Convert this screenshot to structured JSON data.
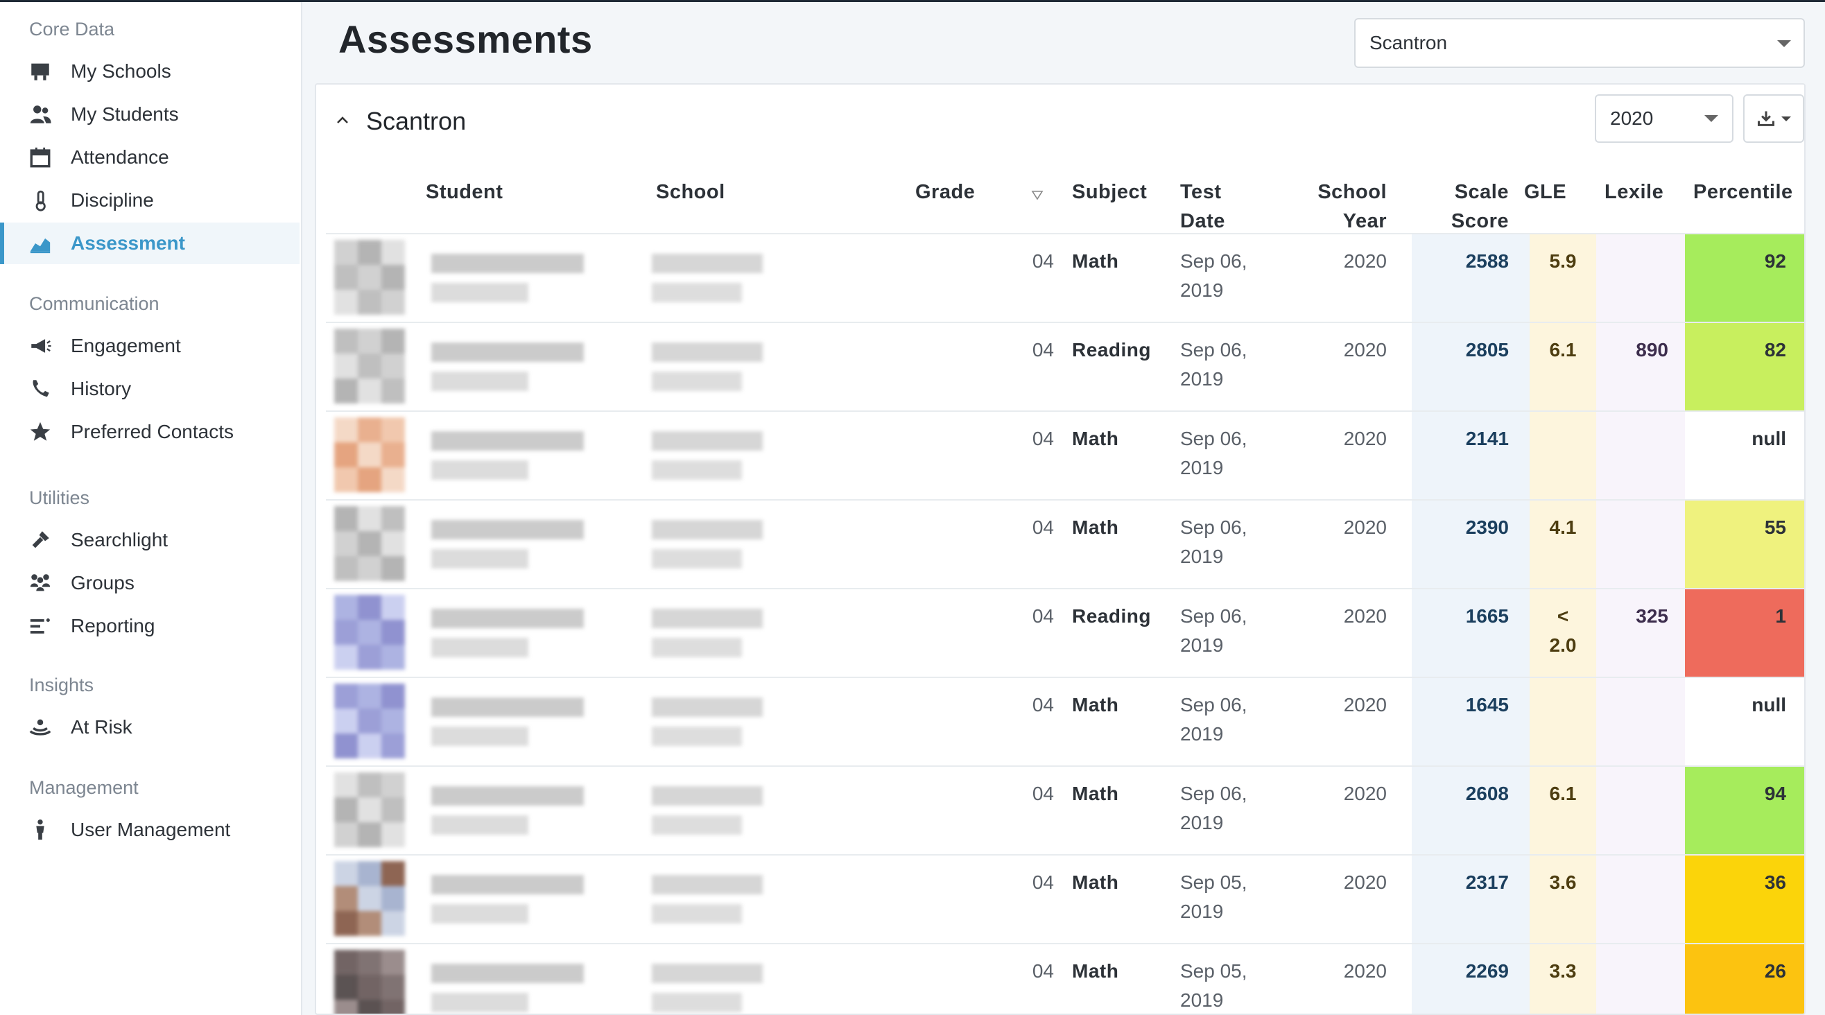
{
  "sidebar": {
    "sections": [
      {
        "heading": "Core Data",
        "items": [
          {
            "label": "My Schools",
            "icon": "school-icon"
          },
          {
            "label": "My Students",
            "icon": "students-icon"
          },
          {
            "label": "Attendance",
            "icon": "calendar-icon"
          },
          {
            "label": "Discipline",
            "icon": "thermometer-icon"
          },
          {
            "label": "Assessment",
            "icon": "area-chart-icon",
            "active": true
          }
        ]
      },
      {
        "heading": "Communication",
        "items": [
          {
            "label": "Engagement",
            "icon": "megaphone-icon"
          },
          {
            "label": "History",
            "icon": "phone-icon"
          },
          {
            "label": "Preferred Contacts",
            "icon": "star-icon"
          }
        ]
      },
      {
        "heading": "Utilities",
        "items": [
          {
            "label": "Searchlight",
            "icon": "flashlight-icon"
          },
          {
            "label": "Groups",
            "icon": "groups-icon"
          },
          {
            "label": "Reporting",
            "icon": "list-icon"
          }
        ]
      },
      {
        "heading": "Insights",
        "items": [
          {
            "label": "At Risk",
            "icon": "lifebuoy-icon"
          }
        ]
      },
      {
        "heading": "Management",
        "items": [
          {
            "label": "User Management",
            "icon": "person-icon"
          }
        ]
      }
    ]
  },
  "header": {
    "title": "Assessments",
    "assessment_select": "Scantron"
  },
  "panel": {
    "title": "Scantron",
    "year_select": "2020"
  },
  "table": {
    "columns": {
      "student": "Student",
      "school": "School",
      "grade": "Grade",
      "subject": "Subject",
      "test_date_1": "Test",
      "test_date_2": "Date",
      "school_year_1": "School",
      "school_year_2": "Year",
      "scale_score_1": "Scale",
      "scale_score_2": "Score",
      "gle": "GLE",
      "lexile": "Lexile",
      "percentile": "Percentile"
    },
    "rows": [
      {
        "grade": "04",
        "subject": "Math",
        "date1": "Sep 06,",
        "date2": "2019",
        "year": "2020",
        "score": "2588",
        "gle1": "5.9",
        "gle2": "",
        "lexile": "",
        "percentile": "92",
        "pct_color": "#a6ec5c",
        "avatar": "gray"
      },
      {
        "grade": "04",
        "subject": "Reading",
        "date1": "Sep 06,",
        "date2": "2019",
        "year": "2020",
        "score": "2805",
        "gle1": "6.1",
        "gle2": "",
        "lexile": "890",
        "percentile": "82",
        "pct_color": "#c8ef5e",
        "avatar": "gray"
      },
      {
        "grade": "04",
        "subject": "Math",
        "date1": "Sep 06,",
        "date2": "2019",
        "year": "2020",
        "score": "2141",
        "gle1": "",
        "gle2": "",
        "lexile": "",
        "percentile": "null",
        "pct_color": "#ffffff",
        "avatar": "peach"
      },
      {
        "grade": "04",
        "subject": "Math",
        "date1": "Sep 06,",
        "date2": "2019",
        "year": "2020",
        "score": "2390",
        "gle1": "4.1",
        "gle2": "",
        "lexile": "",
        "percentile": "55",
        "pct_color": "#eff27e",
        "avatar": "gray"
      },
      {
        "grade": "04",
        "subject": "Reading",
        "date1": "Sep 06,",
        "date2": "2019",
        "year": "2020",
        "score": "1665",
        "gle1": "<",
        "gle2": "2.0",
        "lexile": "325",
        "percentile": "1",
        "pct_color": "#ee6b5c",
        "avatar": "blue"
      },
      {
        "grade": "04",
        "subject": "Math",
        "date1": "Sep 06,",
        "date2": "2019",
        "year": "2020",
        "score": "1645",
        "gle1": "",
        "gle2": "",
        "lexile": "",
        "percentile": "null",
        "pct_color": "#ffffff",
        "avatar": "blue"
      },
      {
        "grade": "04",
        "subject": "Math",
        "date1": "Sep 06,",
        "date2": "2019",
        "year": "2020",
        "score": "2608",
        "gle1": "6.1",
        "gle2": "",
        "lexile": "",
        "percentile": "94",
        "pct_color": "#a6ec5c",
        "avatar": "gray"
      },
      {
        "grade": "04",
        "subject": "Math",
        "date1": "Sep 05,",
        "date2": "2019",
        "year": "2020",
        "score": "2317",
        "gle1": "3.6",
        "gle2": "",
        "lexile": "",
        "percentile": "36",
        "pct_color": "#fbd40a",
        "avatar": "brown"
      },
      {
        "grade": "04",
        "subject": "Math",
        "date1": "Sep 05,",
        "date2": "2019",
        "year": "2020",
        "score": "2269",
        "gle1": "3.3",
        "gle2": "",
        "lexile": "",
        "percentile": "26",
        "pct_color": "#fcc310",
        "avatar": "dark"
      }
    ]
  },
  "colors": {
    "accent": "#3b97c9",
    "scale_score_band": "#eef4fa",
    "gle_band": "#fdf5dd",
    "lexile_band": "#f8f4fb"
  }
}
